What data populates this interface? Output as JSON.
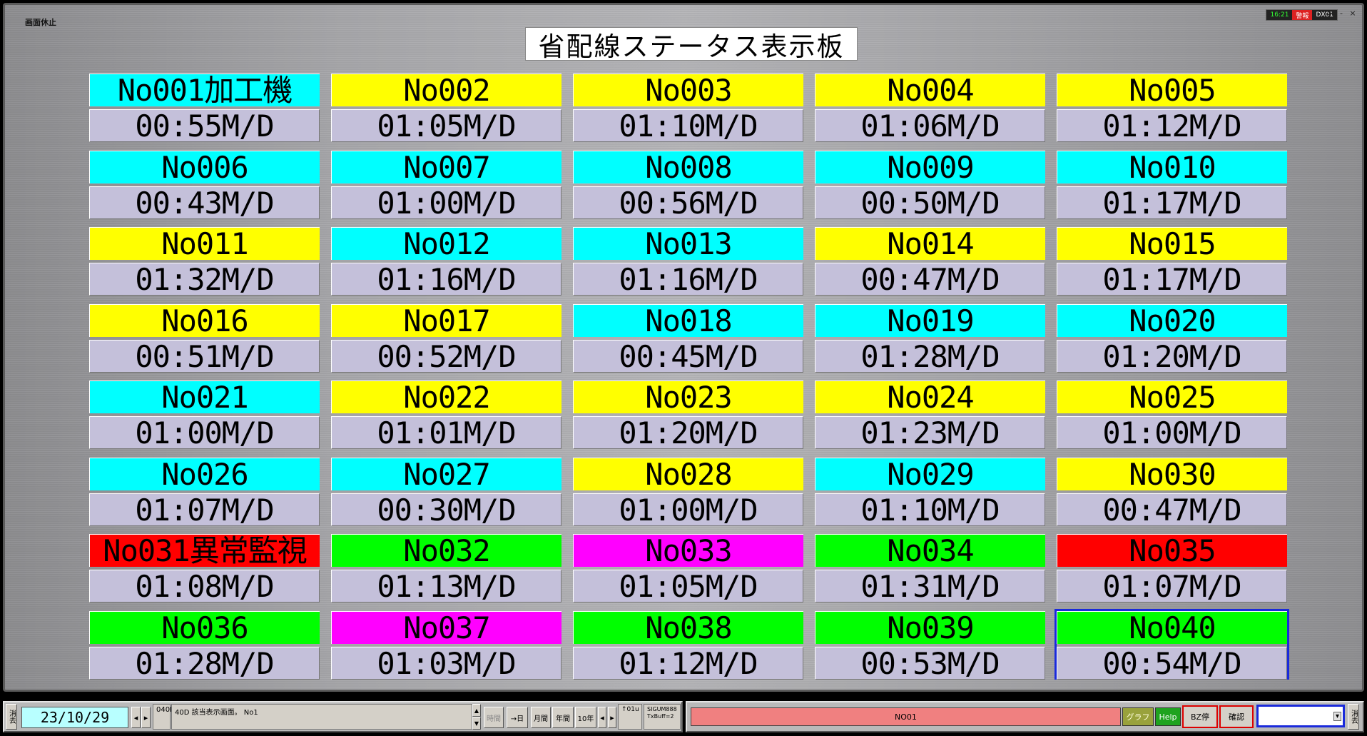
{
  "header": {
    "pause_label": "画面休止",
    "status_mini": {
      "time": "16:21",
      "alarm": "警報",
      "station": "DX01"
    },
    "window_buttons": {
      "more": ">",
      "minimize": "-",
      "close": "×"
    }
  },
  "board": {
    "title": "省配線ステータス表示板",
    "tiles": [
      {
        "name": "No001加工機",
        "time": "00:55M/D",
        "color": "#00ffff",
        "color_class": "c-cyan"
      },
      {
        "name": "No002",
        "time": "01:05M/D",
        "color": "#ffff00",
        "color_class": "c-yellow"
      },
      {
        "name": "No003",
        "time": "01:10M/D",
        "color": "#ffff00",
        "color_class": "c-yellow"
      },
      {
        "name": "No004",
        "time": "01:06M/D",
        "color": "#ffff00",
        "color_class": "c-yellow"
      },
      {
        "name": "No005",
        "time": "01:12M/D",
        "color": "#ffff00",
        "color_class": "c-yellow"
      },
      {
        "name": "No006",
        "time": "00:43M/D",
        "color": "#00ffff",
        "color_class": "c-cyan"
      },
      {
        "name": "No007",
        "time": "01:00M/D",
        "color": "#00ffff",
        "color_class": "c-cyan"
      },
      {
        "name": "No008",
        "time": "00:56M/D",
        "color": "#00ffff",
        "color_class": "c-cyan"
      },
      {
        "name": "No009",
        "time": "00:50M/D",
        "color": "#00ffff",
        "color_class": "c-cyan"
      },
      {
        "name": "No010",
        "time": "01:17M/D",
        "color": "#00ffff",
        "color_class": "c-cyan"
      },
      {
        "name": "No011",
        "time": "01:32M/D",
        "color": "#ffff00",
        "color_class": "c-yellow"
      },
      {
        "name": "No012",
        "time": "01:16M/D",
        "color": "#00ffff",
        "color_class": "c-cyan"
      },
      {
        "name": "No013",
        "time": "01:16M/D",
        "color": "#00ffff",
        "color_class": "c-cyan"
      },
      {
        "name": "No014",
        "time": "00:47M/D",
        "color": "#ffff00",
        "color_class": "c-yellow"
      },
      {
        "name": "No015",
        "time": "01:17M/D",
        "color": "#ffff00",
        "color_class": "c-yellow"
      },
      {
        "name": "No016",
        "time": "00:51M/D",
        "color": "#ffff00",
        "color_class": "c-yellow"
      },
      {
        "name": "No017",
        "time": "00:52M/D",
        "color": "#ffff00",
        "color_class": "c-yellow"
      },
      {
        "name": "No018",
        "time": "00:45M/D",
        "color": "#00ffff",
        "color_class": "c-cyan"
      },
      {
        "name": "No019",
        "time": "01:28M/D",
        "color": "#00ffff",
        "color_class": "c-cyan"
      },
      {
        "name": "No020",
        "time": "01:20M/D",
        "color": "#00ffff",
        "color_class": "c-cyan"
      },
      {
        "name": "No021",
        "time": "01:00M/D",
        "color": "#00ffff",
        "color_class": "c-cyan"
      },
      {
        "name": "No022",
        "time": "01:01M/D",
        "color": "#ffff00",
        "color_class": "c-yellow"
      },
      {
        "name": "No023",
        "time": "01:20M/D",
        "color": "#ffff00",
        "color_class": "c-yellow"
      },
      {
        "name": "No024",
        "time": "01:23M/D",
        "color": "#ffff00",
        "color_class": "c-yellow"
      },
      {
        "name": "No025",
        "time": "01:00M/D",
        "color": "#ffff00",
        "color_class": "c-yellow"
      },
      {
        "name": "No026",
        "time": "01:07M/D",
        "color": "#00ffff",
        "color_class": "c-cyan"
      },
      {
        "name": "No027",
        "time": "00:30M/D",
        "color": "#00ffff",
        "color_class": "c-cyan"
      },
      {
        "name": "No028",
        "time": "01:00M/D",
        "color": "#ffff00",
        "color_class": "c-yellow"
      },
      {
        "name": "No029",
        "time": "01:10M/D",
        "color": "#00ffff",
        "color_class": "c-cyan"
      },
      {
        "name": "No030",
        "time": "00:47M/D",
        "color": "#ffff00",
        "color_class": "c-yellow"
      },
      {
        "name": "No031異常監視",
        "time": "01:08M/D",
        "color": "#ff0000",
        "color_class": "c-red"
      },
      {
        "name": "No032",
        "time": "01:13M/D",
        "color": "#00ff00",
        "color_class": "c-green"
      },
      {
        "name": "No033",
        "time": "01:05M/D",
        "color": "#ff00ff",
        "color_class": "c-magenta"
      },
      {
        "name": "No034",
        "time": "01:31M/D",
        "color": "#00ff00",
        "color_class": "c-green"
      },
      {
        "name": "No035",
        "time": "01:07M/D",
        "color": "#ff0000",
        "color_class": "c-red"
      },
      {
        "name": "No036",
        "time": "01:28M/D",
        "color": "#00ff00",
        "color_class": "c-green"
      },
      {
        "name": "No037",
        "time": "01:03M/D",
        "color": "#ff00ff",
        "color_class": "c-magenta"
      },
      {
        "name": "No038",
        "time": "01:12M/D",
        "color": "#00ff00",
        "color_class": "c-green"
      },
      {
        "name": "No039",
        "time": "00:53M/D",
        "color": "#00ff00",
        "color_class": "c-green"
      },
      {
        "name": "No040",
        "time": "00:54M/D",
        "color": "#00ff00",
        "color_class": "c-green",
        "selected": true
      }
    ]
  },
  "footer": {
    "erase_left": "消去",
    "date": "23/10/29",
    "prev": "◂",
    "next": "▸",
    "code": "040D",
    "message": "40D 該当表示画面。 No1",
    "spin_up": "▲",
    "spin_down": "▼",
    "btn_time": "時間",
    "btn_1day": "→日",
    "btn_month": "月間",
    "btn_year": "年間",
    "btn_10year": "10年",
    "btn_step": "↑01u",
    "sig_text": "SIGUM888 TxBuff=2",
    "status_text": "NO01",
    "btn_graph": "グラフ",
    "btn_help": "Help",
    "btn_bz_stop": "BZ停",
    "btn_confirm": "確認",
    "select_arrow": "▾",
    "erase_right": "消去"
  }
}
